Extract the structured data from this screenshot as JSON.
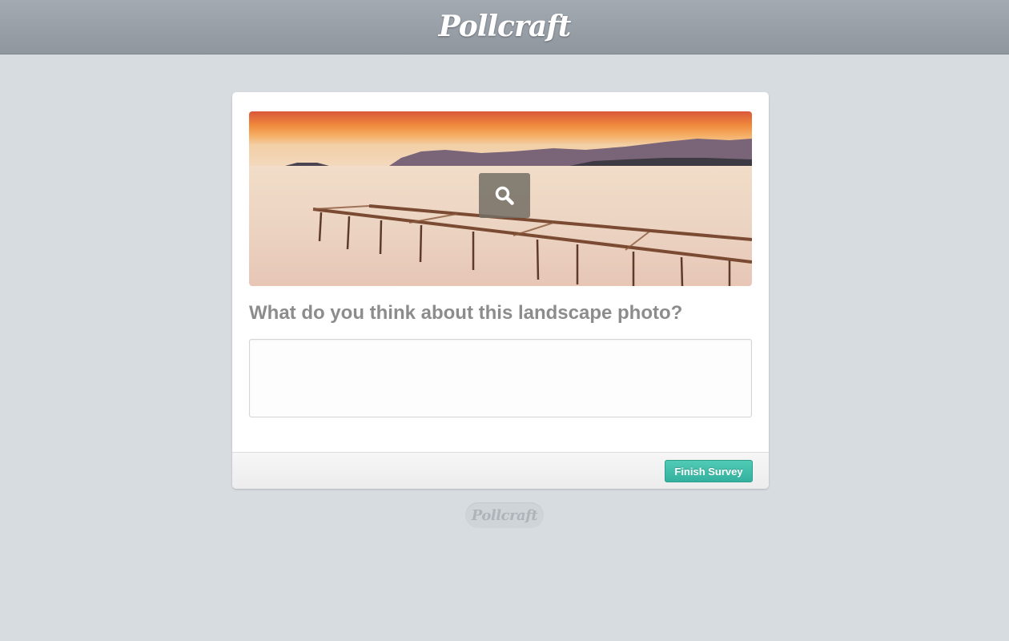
{
  "header": {
    "logo_text": "Pollcraft"
  },
  "survey": {
    "image_icon": "search-icon",
    "question": "What do you think about this landscape photo?",
    "answer_value": "",
    "answer_placeholder": ""
  },
  "footer": {
    "finish_label": "Finish Survey"
  },
  "powered_by": {
    "logo_text": "Pollcraft"
  },
  "colors": {
    "accent": "#3dbca7",
    "header_bg": "#9aa1a9",
    "page_bg": "#d7dce0",
    "question_text": "#8c8c8c"
  }
}
